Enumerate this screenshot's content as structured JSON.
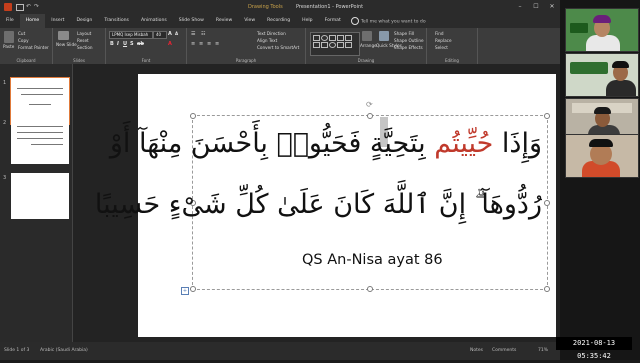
{
  "titlebar": {
    "context_tab": "Drawing Tools",
    "document_title": "Presentation1 - PowerPoint",
    "controls": [
      "–",
      "☐",
      "✕"
    ]
  },
  "ribbon_tabs": [
    "File",
    "Home",
    "Insert",
    "Design",
    "Transitions",
    "Animations",
    "Slide Show",
    "Review",
    "View",
    "Recording",
    "Help",
    "Format"
  ],
  "active_tab": "Home",
  "tell_me": "Tell me what you want to do",
  "ribbon": {
    "clipboard": {
      "paste": "Paste",
      "cut": "Cut",
      "copy": "Copy",
      "format_painter": "Format Painter",
      "label": "Clipboard"
    },
    "slides": {
      "new_slide": "New Slide",
      "layout": "Layout",
      "reset": "Reset",
      "section": "Section",
      "label": "Slides"
    },
    "font": {
      "name": "LPMQ Isep Misbah",
      "size": "40",
      "label": "Font"
    },
    "paragraph": {
      "text_direction": "Text Direction",
      "align_text": "Align Text",
      "convert_smartart": "Convert to SmartArt",
      "label": "Paragraph"
    },
    "drawing": {
      "arrange": "Arrange",
      "quick_styles": "Quick Styles",
      "shape_fill": "Shape Fill",
      "shape_outline": "Shape Outline",
      "shape_effects": "Shape Effects",
      "label": "Drawing"
    },
    "editing": {
      "find": "Find",
      "replace": "Replace",
      "select": "Select",
      "label": "Editing"
    }
  },
  "slide_panel": {
    "thumbnails": [
      {
        "number": "1",
        "selected": true
      },
      {
        "number": "2",
        "selected": false
      },
      {
        "number": "3",
        "selected": false
      }
    ]
  },
  "slide": {
    "arabic_line1": "وَإِذَا حُيِّيتُم بِتَحِيَّةٍ فَحَيُّوا۟ بِأَحْسَنَ مِنْهَآ أَوْ",
    "arabic_line1_red": "حُيِّيتُم",
    "arabic_line2": "رُدُّوهَآ ۗ إِنَّ ٱللَّهَ كَانَ عَلَىٰ كُلِّ شَىْءٍ حَسِيبًا",
    "reference": "QS An-Nisa ayat 86"
  },
  "status": {
    "slide_info": "Slide 1 of 3",
    "language": "Arabic (Saudi Arabia)",
    "notes": "Notes",
    "comments": "Comments",
    "zoom": "71%"
  },
  "clock": "2021-08-13  05:35:42",
  "colors": {
    "accent_red": "#c0392b",
    "ribbon_bg": "#3c3c3c",
    "title_bg": "#2b2b2b"
  }
}
